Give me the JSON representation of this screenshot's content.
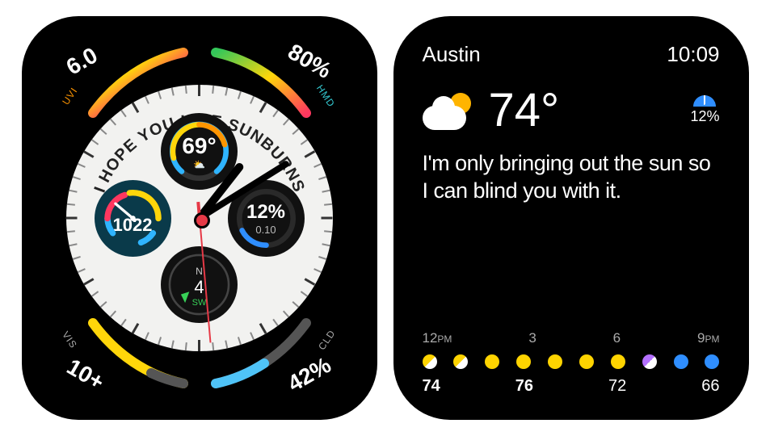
{
  "left": {
    "curved_message": "I HOPE YOU LIKE SUNBURNS",
    "corners": {
      "tl": {
        "label": "UVI",
        "value": "6.0"
      },
      "tr": {
        "label": "HMD",
        "value": "80%"
      },
      "bl": {
        "label": "VIS",
        "value": "10+"
      },
      "br": {
        "label": "CLD",
        "value": "42%"
      }
    },
    "subdials": {
      "top_temp": "69°",
      "right_precip": {
        "pct": "12%",
        "amount": "0.10"
      },
      "left_pressure": "1022",
      "bottom_compass": {
        "top": "N",
        "center": "4",
        "bottom": "SW"
      }
    }
  },
  "right": {
    "location": "Austin",
    "time": "10:09",
    "current_temp": "74°",
    "precip_chance": "12%",
    "message": "I'm only bringing out the sun so I can blind you with it.",
    "hourly": {
      "times": [
        "12PM",
        "3",
        "6",
        "9PM"
      ],
      "conditions": [
        "partly",
        "partly",
        "sunny",
        "sunny",
        "sunny",
        "sunny",
        "sunny",
        "cloudy-partly",
        "cloudy",
        "cloudy"
      ],
      "temps": [
        "74",
        "76",
        "72",
        "66"
      ],
      "high_index": 1
    }
  }
}
